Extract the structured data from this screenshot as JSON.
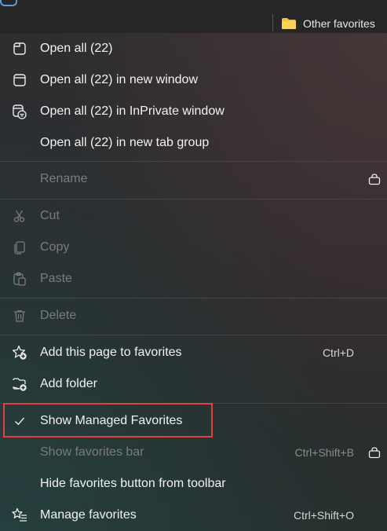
{
  "toolbar": {
    "other_favorites_label": "Other favorites"
  },
  "menu": {
    "open_all": "Open all (22)",
    "open_all_new_window": "Open all (22) in new window",
    "open_all_inprivate": "Open all (22) in InPrivate window",
    "open_all_tab_group": "Open all (22) in new tab group",
    "rename": "Rename",
    "cut": "Cut",
    "copy": "Copy",
    "paste": "Paste",
    "delete": "Delete",
    "add_page": "Add this page to favorites",
    "add_page_shortcut": "Ctrl+D",
    "add_folder": "Add folder",
    "show_managed": "Show Managed Favorites",
    "show_bar": "Show favorites bar",
    "show_bar_shortcut": "Ctrl+Shift+B",
    "hide_button": "Hide favorites button from toolbar",
    "manage": "Manage favorites",
    "manage_shortcut": "Ctrl+Shift+O"
  },
  "colors": {
    "highlight_border": "#e0403f",
    "folder": "#f3c33c",
    "text": "#f2f2f2",
    "disabled_text": "#7b7b7d"
  }
}
